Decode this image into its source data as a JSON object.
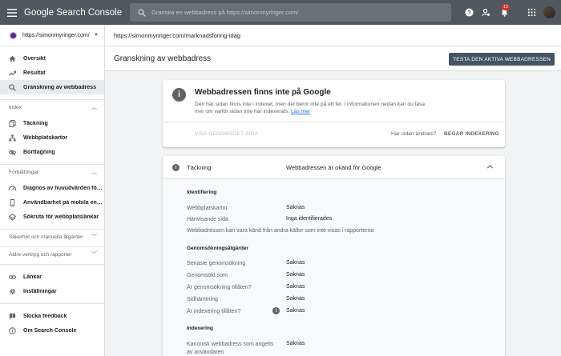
{
  "app": {
    "title": "Google Search Console"
  },
  "search": {
    "placeholder": "Granska en webbadress på https://simonmyringer.com/"
  },
  "notifications": {
    "count": "13"
  },
  "property": {
    "name": "https://simonmyringer.com/"
  },
  "sidebar": {
    "main": [
      {
        "label": "Översikt",
        "icon": "home-icon"
      },
      {
        "label": "Resultat",
        "icon": "trending-up-icon"
      },
      {
        "label": "Granskning av webbadress",
        "icon": "search-icon"
      }
    ],
    "index_header": "Index",
    "index": [
      {
        "label": "Täckning",
        "icon": "file-copy-icon"
      },
      {
        "label": "Webbplatskartor",
        "icon": "sitemap-icon"
      },
      {
        "label": "Borttagning",
        "icon": "visibility-off-icon"
      }
    ],
    "improvements_header": "Förbättringar",
    "improvements": [
      {
        "label": "Diagnos av huvudvärden för we...",
        "icon": "speed-icon"
      },
      {
        "label": "Användbarhet på mobila enheter",
        "icon": "smartphone-icon"
      },
      {
        "label": "Sökruta för webbplatslänkar",
        "icon": "layers-icon"
      }
    ],
    "security_header": "Säkerhet och manuella åtgärder",
    "legacy_header": "Äldre verktyg och rapporter",
    "bottom": [
      {
        "label": "Länkar",
        "icon": "link-icon"
      },
      {
        "label": "Inställningar",
        "icon": "settings-icon"
      }
    ],
    "footer": [
      {
        "label": "Skicka feedback",
        "icon": "feedback-icon"
      },
      {
        "label": "Om Search Console",
        "icon": "info-icon"
      }
    ]
  },
  "url": {
    "inspected": "https://simonmyringer.com/marknadsforing-idag"
  },
  "page": {
    "title": "Granskning av webbadress",
    "test_button": "TESTA DEN AKTIVA WEBBADRESSEN"
  },
  "status": {
    "title": "Webbadressen finns inte på Google",
    "description": "Den här sidan finns inte i indexet, men det beror inte på ett fel. I informationen nedan kan du läsa mer om varför sidan inte har indexerats.",
    "learn_more": "Läs mer",
    "view_crawled": "VISA GENOMSÖKT SIDA",
    "changed_question": "Har sidan ändrats?",
    "request_indexing": "BEGÄR INDEXERING"
  },
  "coverage": {
    "label": "Täckning",
    "value": "Webbadressen är okänd för Google",
    "identification": {
      "header": "Identifiering",
      "rows": [
        {
          "key": "Webbplatskartor",
          "value": "Saknas"
        },
        {
          "key": "Hänvisande sida",
          "value": "Inga identifierades"
        }
      ],
      "note": "Webbadressen kan vara känd från andra källor som inte visas i rapporterna"
    },
    "crawl": {
      "header": "Genomsökningsåtgärder",
      "rows": [
        {
          "key": "Senaste genomsökning",
          "value": "Saknas"
        },
        {
          "key": "Genomsökt som",
          "value": "Saknas"
        },
        {
          "key": "Är genomsökning tillåten?",
          "value": "Saknas"
        },
        {
          "key": "Sidhämtning",
          "value": "Saknas"
        },
        {
          "key": "Är indexering tillåten?",
          "value": "Saknas"
        }
      ]
    },
    "indexing": {
      "header": "Indexering",
      "rows": [
        {
          "key": "Kanonisk webbadress som angetts av användaren",
          "value": "Saknas"
        }
      ]
    }
  }
}
